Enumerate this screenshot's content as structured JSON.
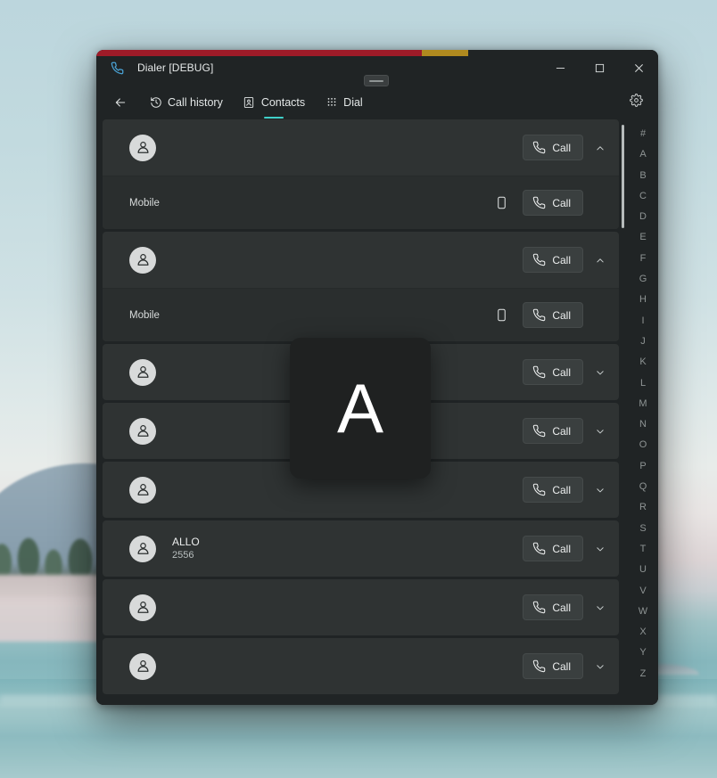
{
  "window": {
    "title": "Dialer [DEBUG]",
    "app_icon": "phone-icon",
    "minimize_label": "–",
    "maximize_label": "□",
    "close_label": "✕"
  },
  "accent_bar": {
    "segment_1_color": "#9e1b28",
    "segment_2_color": "#b08a1f"
  },
  "nav": {
    "back_label": "←",
    "settings_icon": "gear-icon",
    "tabs": [
      {
        "label": "Call history",
        "icon": "call-history-icon",
        "active": false
      },
      {
        "label": "Contacts",
        "icon": "contacts-book-icon",
        "active": true
      },
      {
        "label": "Dial",
        "icon": "dialpad-icon",
        "active": false
      }
    ],
    "active_tab_indicator_color": "#3fd0c9"
  },
  "contacts": {
    "call_label": "Call",
    "number_label_mobile": "Mobile",
    "items": [
      {
        "name": "",
        "subtitle": "",
        "expanded": true,
        "numbers": [
          {
            "label": "Mobile",
            "call_label": "Call"
          }
        ]
      },
      {
        "name": "",
        "subtitle": "",
        "expanded": true,
        "numbers": [
          {
            "label": "Mobile",
            "call_label": "Call"
          }
        ]
      },
      {
        "name": "",
        "subtitle": "",
        "expanded": false,
        "numbers": []
      },
      {
        "name": "",
        "subtitle": "",
        "expanded": false,
        "numbers": []
      },
      {
        "name": "",
        "subtitle": "",
        "expanded": false,
        "numbers": []
      },
      {
        "name": "ALLO",
        "subtitle": "2556",
        "expanded": false,
        "numbers": []
      },
      {
        "name": "",
        "subtitle": "",
        "expanded": false,
        "numbers": []
      },
      {
        "name": "",
        "subtitle": "",
        "expanded": false,
        "numbers": []
      }
    ]
  },
  "alpha_index": {
    "letters": [
      "#",
      "A",
      "B",
      "C",
      "D",
      "E",
      "F",
      "G",
      "H",
      "I",
      "J",
      "K",
      "L",
      "M",
      "N",
      "O",
      "P",
      "Q",
      "R",
      "S",
      "T",
      "U",
      "V",
      "W",
      "X",
      "Y",
      "Z"
    ]
  },
  "letter_overlay": {
    "letter": "A"
  }
}
